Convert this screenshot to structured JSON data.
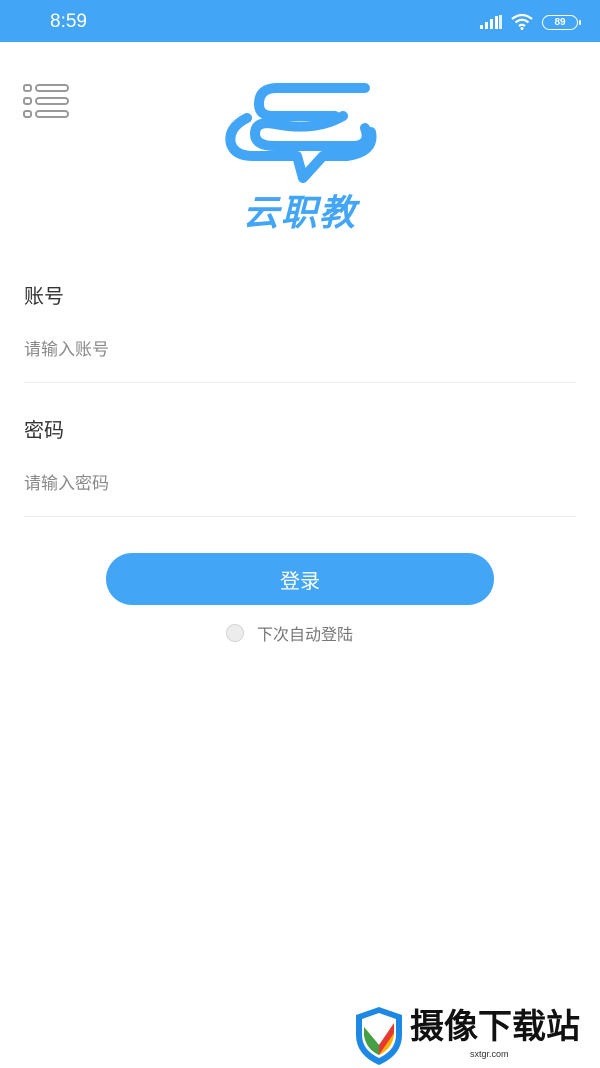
{
  "status_bar": {
    "time": "8:59",
    "battery": "89",
    "icons": [
      "signal-icon",
      "wifi-icon",
      "battery-icon"
    ]
  },
  "colors": {
    "primary": "#42a5f5",
    "text": "#333333",
    "placeholder": "#8a8a8a",
    "divider": "#ececec"
  },
  "app": {
    "logo_text": "云职教"
  },
  "form": {
    "account_label": "账号",
    "account_placeholder": "请输入账号",
    "password_label": "密码",
    "password_placeholder": "请输入密码",
    "login_button": "登录",
    "auto_login_label": "下次自动登陆",
    "auto_login_checked": false
  },
  "watermark": {
    "text": "摄像下载站",
    "url": "sxtgr.com"
  }
}
